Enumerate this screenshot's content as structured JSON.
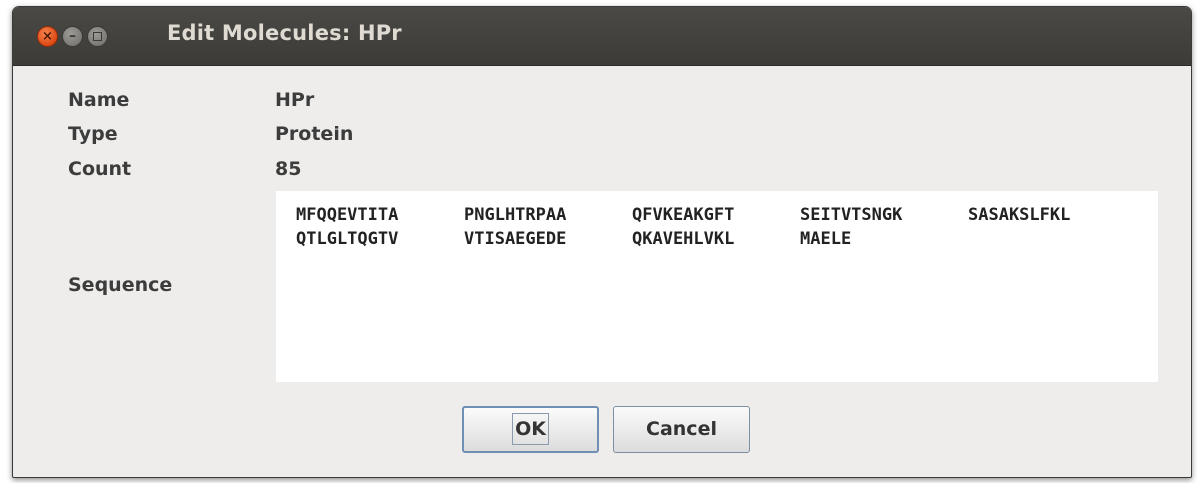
{
  "window": {
    "title": "Edit Molecules: HPr",
    "controls": {
      "close_icon": "close-icon",
      "minimize_icon": "minimize-icon",
      "maximize_icon": "maximize-icon"
    }
  },
  "fields": {
    "name_label": "Name",
    "name_value": "HPr",
    "type_label": "Type",
    "type_value": "Protein",
    "count_label": "Count",
    "count_value": "85",
    "sequence_label": "Sequence"
  },
  "sequence": {
    "line1": [
      "MFQQEVTITA",
      "PNGLHTRPAA",
      "QFVKEAKGFT",
      "SEITVTSNGK",
      "SASAKSLFKL"
    ],
    "line2": [
      "QTLGLTQGTV",
      "VTISAEGEDE",
      "QKAVEHLVKL",
      "MAELE"
    ]
  },
  "buttons": {
    "ok_label": "OK",
    "cancel_label": "Cancel"
  },
  "colors": {
    "titlebar": "#3c3b37",
    "close_button": "#dd4814",
    "dialog_background": "#eeedeb"
  }
}
